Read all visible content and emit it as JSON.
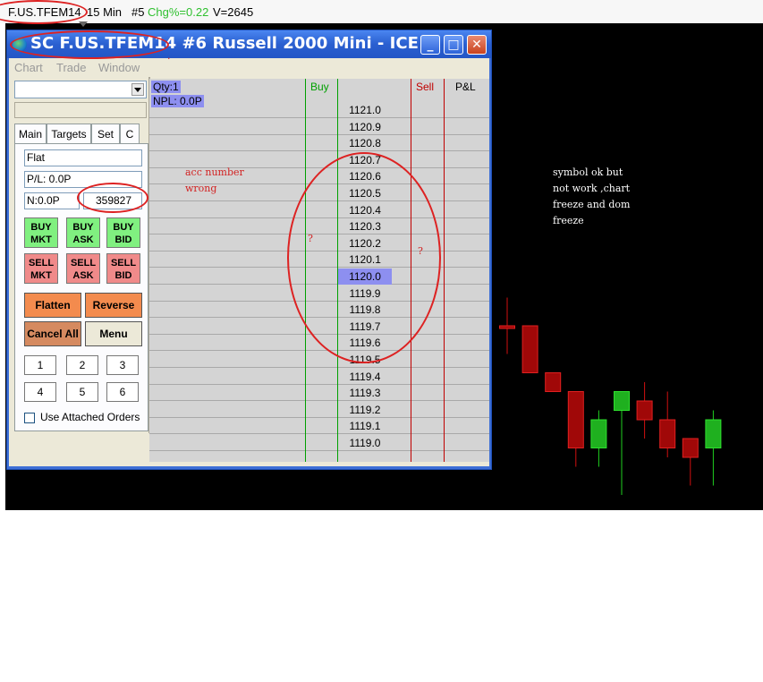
{
  "chart_header": {
    "symbol": "F.US.TFEM14",
    "interval": "15 Min",
    "chart_no": "#5",
    "chg": "Chg%=0.22",
    "volume": "V=2645"
  },
  "colors": {
    "chg_green": "#30c030",
    "buy_green": "#00a000",
    "sell_red": "#c00000",
    "annotation_red": "#d22222",
    "highlight_price": "#8d8ff0",
    "title_blue": "#2a5fd0"
  },
  "dom_window": {
    "title": "SC F.US.TFEM14 #6  Russell 2000 Mini - ICE",
    "menu": [
      "Chart",
      "Trade",
      "Window"
    ],
    "controls": {
      "minimize": "_",
      "maximize": "□",
      "close": "✕"
    }
  },
  "left_panel": {
    "tabs": [
      "Main",
      "Targets",
      "Set",
      "C"
    ],
    "position_field": "Flat",
    "pl_field": "P/L: 0.0P",
    "n_field": "N:0.0P",
    "account_number": "359827",
    "buttons": {
      "buy_mkt": [
        "BUY",
        "MKT"
      ],
      "buy_ask": [
        "BUY",
        "ASK"
      ],
      "buy_bid": [
        "BUY",
        "BID"
      ],
      "sell_mkt": [
        "SELL",
        "MKT"
      ],
      "sell_ask": [
        "SELL",
        "ASK"
      ],
      "sell_bid": [
        "SELL",
        "BID"
      ],
      "flatten": "Flatten",
      "reverse": "Reverse",
      "cancel_all": "Cancel All",
      "menu": "Menu"
    },
    "quantity_buttons": [
      "1",
      "2",
      "3",
      "4",
      "5",
      "6"
    ],
    "use_attached_orders": "Use Attached Orders"
  },
  "dom": {
    "qty": "Qty:1",
    "npl": "NPL: 0.0P",
    "col_buy": "Buy",
    "col_sell": "Sell",
    "col_pl": "P&L",
    "prices": [
      "1121.0",
      "1120.9",
      "1120.8",
      "1120.7",
      "1120.6",
      "1120.5",
      "1120.4",
      "1120.3",
      "1120.2",
      "1120.1",
      "1120.0",
      "1119.9",
      "1119.8",
      "1119.7",
      "1119.6",
      "1119.5",
      "1119.4",
      "1119.3",
      "1119.2",
      "1119.1",
      "1119.0"
    ],
    "highlighted_price": "1120.0"
  },
  "annotations": {
    "acc_line1": "acc number",
    "acc_line2": "wrong",
    "question_buy": "?",
    "question_sell": "?",
    "note_lines": [
      "symbol ok but",
      "not work ,chart",
      "freeze and dom",
      "freeze"
    ],
    "dot": "."
  },
  "chart_data": {
    "type": "candlestick",
    "candles": [
      {
        "open": 1120.7,
        "close": 1120.7,
        "high": 1121.0,
        "low": 1120.4,
        "color": "red"
      },
      {
        "open": 1120.7,
        "close": 1120.2,
        "high": 1120.7,
        "low": 1120.2,
        "color": "red"
      },
      {
        "open": 1120.2,
        "close": 1120.0,
        "high": 1120.2,
        "low": 1120.0,
        "color": "red"
      },
      {
        "open": 1120.0,
        "close": 1119.4,
        "high": 1120.0,
        "low": 1119.2,
        "color": "red"
      },
      {
        "open": 1119.4,
        "close": 1119.7,
        "high": 1119.8,
        "low": 1119.2,
        "color": "green"
      },
      {
        "open": 1119.8,
        "close": 1120.0,
        "high": 1120.0,
        "low": 1118.9,
        "color": "green"
      },
      {
        "open": 1119.9,
        "close": 1119.7,
        "high": 1120.1,
        "low": 1119.5,
        "color": "red"
      },
      {
        "open": 1119.7,
        "close": 1119.4,
        "high": 1120.0,
        "low": 1119.3,
        "color": "red"
      },
      {
        "open": 1119.5,
        "close": 1119.3,
        "high": 1119.5,
        "low": 1119.0,
        "color": "red"
      },
      {
        "open": 1119.4,
        "close": 1119.7,
        "high": 1119.8,
        "low": 1119.0,
        "color": "green"
      }
    ]
  }
}
